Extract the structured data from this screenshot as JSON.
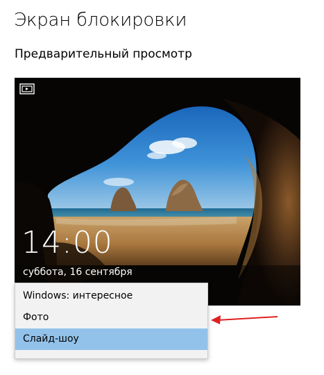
{
  "header": {
    "page_title": "Экран блокировки",
    "section_title": "Предварительный просмотр"
  },
  "preview": {
    "time": "14:00",
    "date": "суббота, 16 сентября",
    "icon": "slideshow-icon"
  },
  "background_dropdown": {
    "items": [
      {
        "label": "Windows: интересное",
        "selected": false
      },
      {
        "label": "Фото",
        "selected": false
      },
      {
        "label": "Слайд-шоу",
        "selected": true
      }
    ]
  },
  "colors": {
    "selected_item": "#92c2ea",
    "annotation_arrow": "#e02020"
  }
}
